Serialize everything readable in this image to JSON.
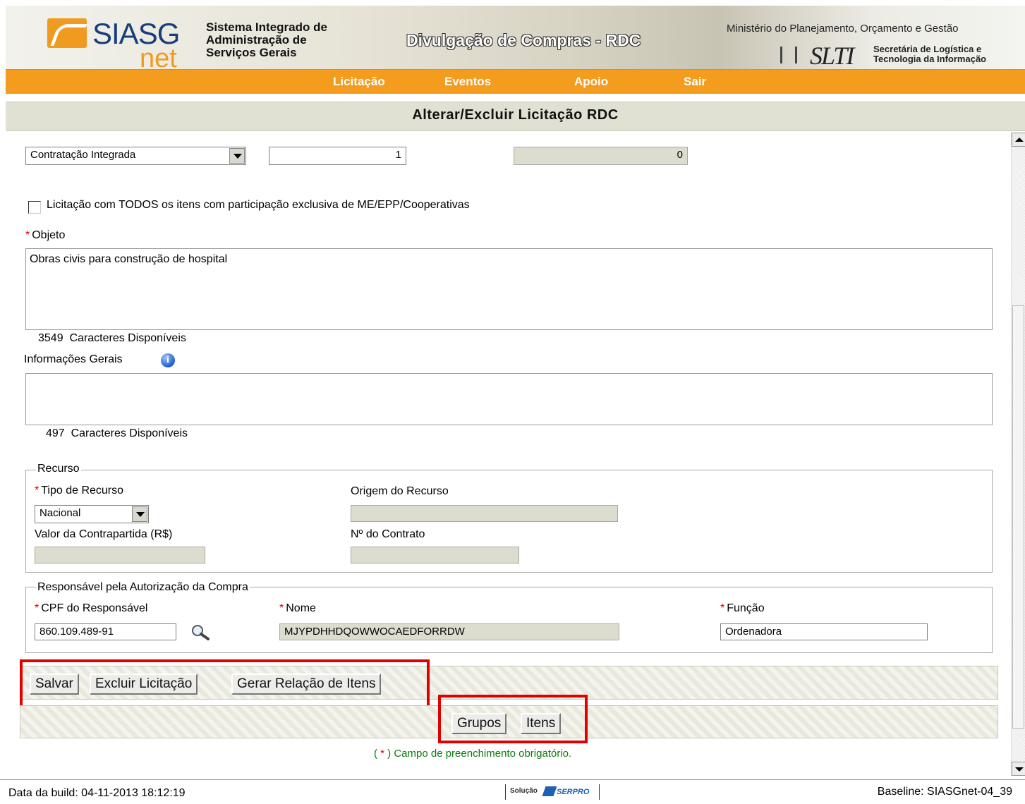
{
  "header": {
    "logo_siasg": "SIASG",
    "logo_net": "net",
    "system_name_line1": "Sistema Integrado de",
    "system_name_line2": "Administração de",
    "system_name_line3": "Serviços Gerais",
    "banner_title": "Divulgação de Compras - RDC",
    "ministry": "Ministério do Planejamento, Orçamento e Gestão",
    "slti": "SLTI",
    "slti_desc_line1": "Secretária de Logística e",
    "slti_desc_line2": "Tecnologia da Informação"
  },
  "menu": {
    "items": [
      {
        "label": "Licitação"
      },
      {
        "label": "Eventos"
      },
      {
        "label": "Apoio"
      },
      {
        "label": "Sair"
      }
    ]
  },
  "page": {
    "title": "Alterar/Excluir Licitação RDC"
  },
  "form": {
    "regime_value": "Contratação Integrada",
    "quantidade_value": "1",
    "total_itens_value": "0",
    "exclusive_checkbox_label": "Licitação com TODOS os itens com participação exclusiva de ME/EPP/Cooperativas",
    "objeto_label": "Objeto",
    "objeto_value": "Obras civis para construção de hospital",
    "objeto_remaining_count": "3549",
    "objeto_remaining_label": "Caracteres Disponíveis",
    "info_gerais_label": "Informações Gerais",
    "info_gerais_value": "",
    "info_remaining_count": "497",
    "info_remaining_label": "Caracteres Disponíveis",
    "recurso": {
      "legend": "Recurso",
      "tipo_label": "Tipo de Recurso",
      "tipo_value": "Nacional",
      "origem_label": "Origem do Recurso",
      "origem_value": "",
      "contrapartida_label": "Valor da Contrapartida (R$)",
      "contrapartida_value": "",
      "contrato_label": "Nº do Contrato",
      "contrato_value": ""
    },
    "responsavel": {
      "legend": "Responsável pela Autorização da Compra",
      "cpf_label": "CPF do Responsável",
      "cpf_value": "860.109.489-91",
      "nome_label": "Nome",
      "nome_value": "MJYPDHHDQOWWOCAEDFORRDW",
      "funcao_label": "Função",
      "funcao_value": "Ordenadora"
    },
    "required_star": "*"
  },
  "actions": {
    "salvar": "Salvar",
    "excluir": "Excluir Licitação",
    "gerar": "Gerar Relação de Itens",
    "grupos": "Grupos",
    "itens": "Itens"
  },
  "required_note": {
    "open": "( ",
    "star": "*",
    "text": " ) Campo de preenchimento obrigatório."
  },
  "footer": {
    "build": "Data da build: 04-11-2013 18:12:19",
    "solucao": "Solução",
    "serpro": "SERPRO",
    "baseline": "Baseline: SIASGnet-04_39"
  },
  "colors": {
    "menu_bg": "#f39c1e",
    "highlight": "#e00000",
    "required": "#dd0000",
    "note_green": "#0c7a0c"
  }
}
